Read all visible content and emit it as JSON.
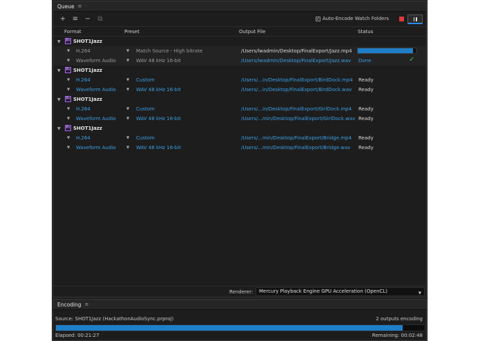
{
  "queue": {
    "tab_label": "Queue",
    "toolbar": {
      "add_icon": "+",
      "settings_icon": "≡",
      "remove_icon": "−",
      "duplicate_icon": "⧉",
      "watch_folders_label": "Auto-Encode Watch Folders",
      "watch_folders_checked": "✓"
    },
    "columns": {
      "format": "Format",
      "preset": "Preset",
      "output": "Output File",
      "status": "Status"
    },
    "groups": [
      {
        "name": "SHOT1Jazz",
        "items": [
          {
            "format": "H.264",
            "preset": "Match Source - High bitrate",
            "output": "/Users/lwadmin/Desktop/FinalExport/Jazz.mp4",
            "status": "",
            "progress": 0.95
          },
          {
            "format": "Waveform Audio",
            "preset": "WAV 48 kHz 16-bit",
            "output": "/Users/lwadmin/Desktop/FinalExport/Jazz.wav",
            "status": "Done"
          }
        ]
      },
      {
        "name": "SHOT1Jazz",
        "items": [
          {
            "format": "H.264",
            "preset": "Custom",
            "output": "/Users/...in/Desktop/FinalExport/BirdDock.mp4",
            "status": "Ready"
          },
          {
            "format": "Waveform Audio",
            "preset": "WAV 48 kHz 16-bit",
            "output": "/Users/...in/Desktop/FinalExport/BirdDock.wav",
            "status": "Ready"
          }
        ]
      },
      {
        "name": "SHOT1Jazz",
        "items": [
          {
            "format": "H.264",
            "preset": "Custom",
            "output": "/Users/...in/Desktop/FinalExport/GirlDock.mp4",
            "status": "Ready"
          },
          {
            "format": "Waveform Audio",
            "preset": "WAV 48 kHz 16-bit",
            "output": "/Users/...min/Desktop/FinalExport/GirlDock.wav",
            "status": "Ready"
          }
        ]
      },
      {
        "name": "SHOT1Jazz",
        "items": [
          {
            "format": "H.264",
            "preset": "Custom",
            "output": "/Users/...min/Desktop/FinalExport/Bridge.mp4",
            "status": "Ready"
          },
          {
            "format": "Waveform Audio",
            "preset": "WAV 48 kHz 16-bit",
            "output": "/Users/...min/Desktop/FinalExport/Bridge.wav",
            "status": "Ready"
          }
        ]
      }
    ],
    "renderer": {
      "label": "Renderer:",
      "value": "Mercury Playback Engine GPU Acceleration (OpenCL)"
    }
  },
  "encoding": {
    "tab_label": "Encoding",
    "source": "Source: SHOT1Jazz (HackathonAudioSync.prproj)",
    "outputs": "2 outputs encoding",
    "progress": 0.94,
    "elapsed": "Elapsed: 00:21:27",
    "remaining": "Remaining: 00:02:48"
  },
  "colors": {
    "accent": "#1f7ec8",
    "link": "#3aa0e8",
    "done_check": "#3fbf3f",
    "stop": "#e03a3a",
    "premiere": "#a466e8"
  },
  "icons": {
    "group_icon": "Pr",
    "done_icon": "✓",
    "menu_icon": "≡"
  }
}
